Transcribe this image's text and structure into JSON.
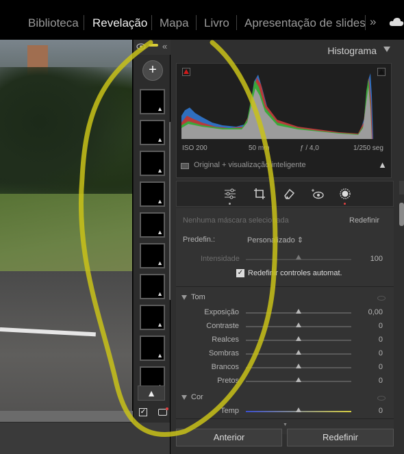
{
  "modules": [
    {
      "label": "Biblioteca",
      "active": false
    },
    {
      "label": "Revelação",
      "active": true
    },
    {
      "label": "Mapa",
      "active": false
    },
    {
      "label": "Livro",
      "active": false
    },
    {
      "label": "Apresentação de slides",
      "active": false
    }
  ],
  "more_label": "»",
  "histogram": {
    "title": "Histograma",
    "iso": "ISO 200",
    "focal": "50 mm",
    "aperture": "ƒ / 4,0",
    "shutter": "1/250 seg",
    "preview_label": "Original + visualização inteligente"
  },
  "masking": {
    "no_mask": "Nenhuma máscara selecionada",
    "reset_label": "Redefinir",
    "preset_label": "Predefin.:",
    "preset_value": "Personalizado ⇕",
    "amount_label": "Intensidade",
    "amount_value": "100",
    "auto_reset_label": "Redefinir controles automat."
  },
  "tone": {
    "title": "Tom",
    "sliders": [
      {
        "label": "Exposição",
        "value": "0,00"
      },
      {
        "label": "Contraste",
        "value": "0"
      },
      {
        "label": "Realces",
        "value": "0"
      },
      {
        "label": "Sombras",
        "value": "0"
      },
      {
        "label": "Brancos",
        "value": "0"
      },
      {
        "label": "Pretos",
        "value": "0"
      }
    ]
  },
  "color": {
    "title": "Cor",
    "sliders": [
      {
        "label": "Temp",
        "value": "0"
      }
    ]
  },
  "buttons": {
    "previous": "Anterior",
    "reset": "Redefinir"
  },
  "warn_glyph": "▲",
  "snapshot_count": 10
}
